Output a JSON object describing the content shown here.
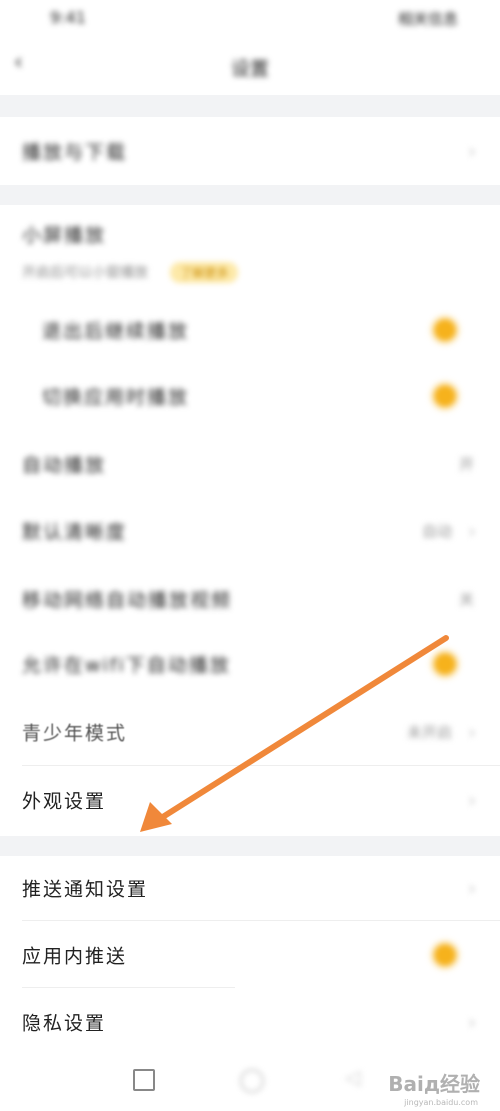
{
  "status_bar": {
    "time": "9:41",
    "right_text": "相关信息"
  },
  "nav": {
    "back_icon": "back-arrow-icon",
    "title": "设置"
  },
  "rows": {
    "playback": {
      "label": "播放与下载"
    },
    "mini_player": {
      "label": "小屏播放"
    },
    "note": {
      "text": "开启后可以小窗播放",
      "tag": "了解更多"
    },
    "sub_one": {
      "label": "退出后继续播放"
    },
    "sub_two": {
      "label": "切换应用时播放"
    },
    "auto_play": {
      "label": "自动播放",
      "value": "开"
    },
    "quality": {
      "label": "默认清晰度",
      "value": "自动"
    },
    "data_saver": {
      "label": "移动网络自动播放视频",
      "value": "关"
    },
    "wifi": {
      "label": "允许在wifi下自动播放"
    },
    "youth": {
      "label": "青少年模式",
      "value": "未开启"
    },
    "appearance": {
      "label": "外观设置"
    },
    "push": {
      "label": "推送通知设置"
    },
    "in_app_push": {
      "label": "应用内推送"
    },
    "privacy": {
      "label": "隐私设置"
    }
  },
  "watermark": {
    "text": "Baiд经验",
    "sub": "jingyan.baidu.com"
  },
  "colors": {
    "toggle_on": "#f6b21c",
    "arrow": "#f0883a",
    "section_gap": "#f2f3f5"
  }
}
